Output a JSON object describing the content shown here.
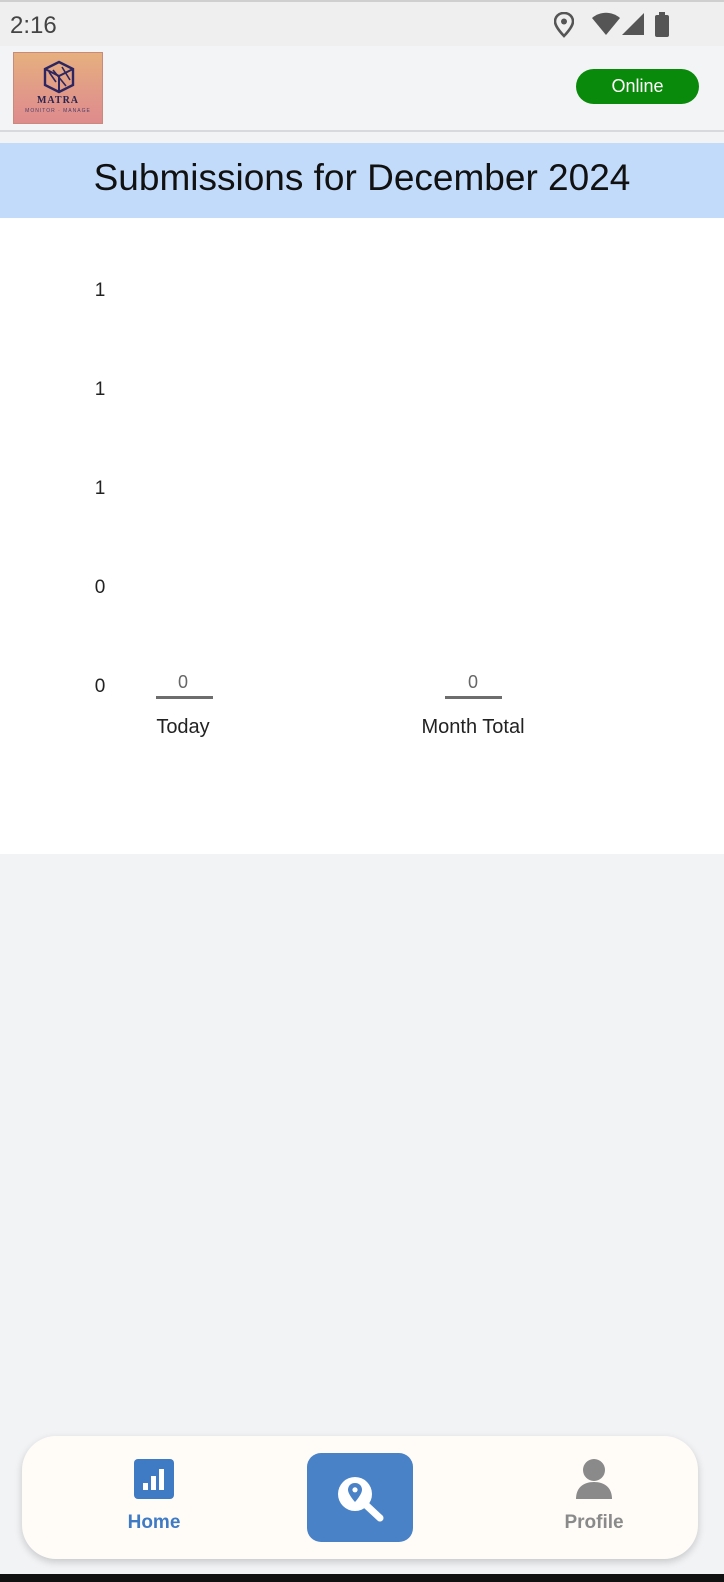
{
  "status_bar": {
    "time": "2:16"
  },
  "header": {
    "logo_text": "MATRA",
    "logo_subtext": "MONITOR · MANAGE",
    "connection_status": "Online",
    "connection_color": "#0a8a0a"
  },
  "page": {
    "title": "Submissions for December 2024"
  },
  "chart_data": {
    "type": "bar",
    "categories": [
      "Today",
      "Month Total"
    ],
    "values": [
      0,
      0
    ],
    "data_labels": [
      "0",
      "0"
    ],
    "y_tick_labels": [
      "1",
      "1",
      "1",
      "0",
      "0"
    ],
    "ylim": [
      0,
      1
    ],
    "grid": false,
    "bar_color": "#6d6d6d"
  },
  "bottom_nav": {
    "items": [
      {
        "label": "Home",
        "icon": "bar-chart-icon",
        "active": true,
        "color": "#3f7ac4"
      },
      {
        "label": "",
        "icon": "location-search-icon",
        "active": false,
        "color": "#ffffff"
      },
      {
        "label": "Profile",
        "icon": "person-icon",
        "active": false,
        "color": "#8a8a8a"
      }
    ]
  }
}
